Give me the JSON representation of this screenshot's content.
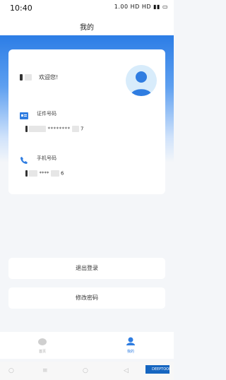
{
  "status_bar": {
    "time": "10:40",
    "icons_text": "1.00 HD HD"
  },
  "header": {
    "title": "我的"
  },
  "profile": {
    "greeting": "欢迎您!"
  },
  "id_info": {
    "label": "证件号码",
    "value_suffix": "7"
  },
  "phone_info": {
    "label": "手机号码",
    "value_suffix": "6"
  },
  "actions": {
    "logout_label": "退出登录",
    "change_password_label": "修改密码"
  },
  "tabbar": {
    "home_label": "首页",
    "mine_label": "我的"
  },
  "watermark": {
    "text": "DEEPTOOR"
  },
  "colors": {
    "accent": "#2f7de1",
    "card": "#ffffff",
    "background": "#f4f6f9"
  }
}
